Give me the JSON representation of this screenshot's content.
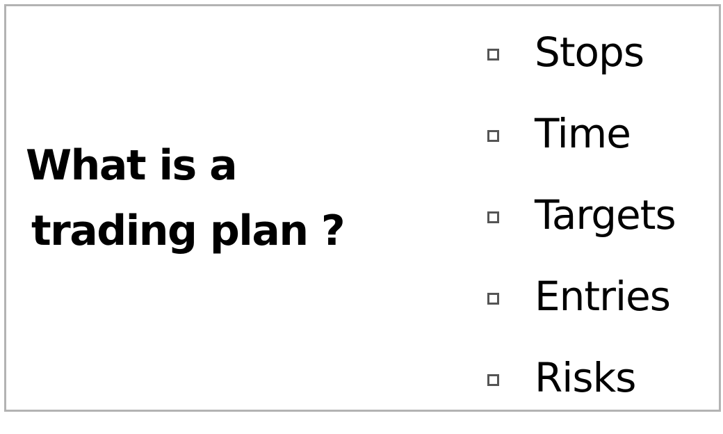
{
  "title": {
    "line1": "What is a",
    "line2": "trading plan ?"
  },
  "bullets": [
    {
      "label": "Stops",
      "icon": "square-bullet-icon"
    },
    {
      "label": "Time",
      "icon": "square-bullet-icon"
    },
    {
      "label": "Targets",
      "icon": "square-bullet-icon"
    },
    {
      "label": "Entries",
      "icon": "square-bullet-icon"
    },
    {
      "label": "Risks",
      "icon": "square-bullet-icon"
    }
  ],
  "colors": {
    "border": "#b3b3b3",
    "text": "#000000",
    "bullet": "#555555",
    "background": "#ffffff"
  }
}
